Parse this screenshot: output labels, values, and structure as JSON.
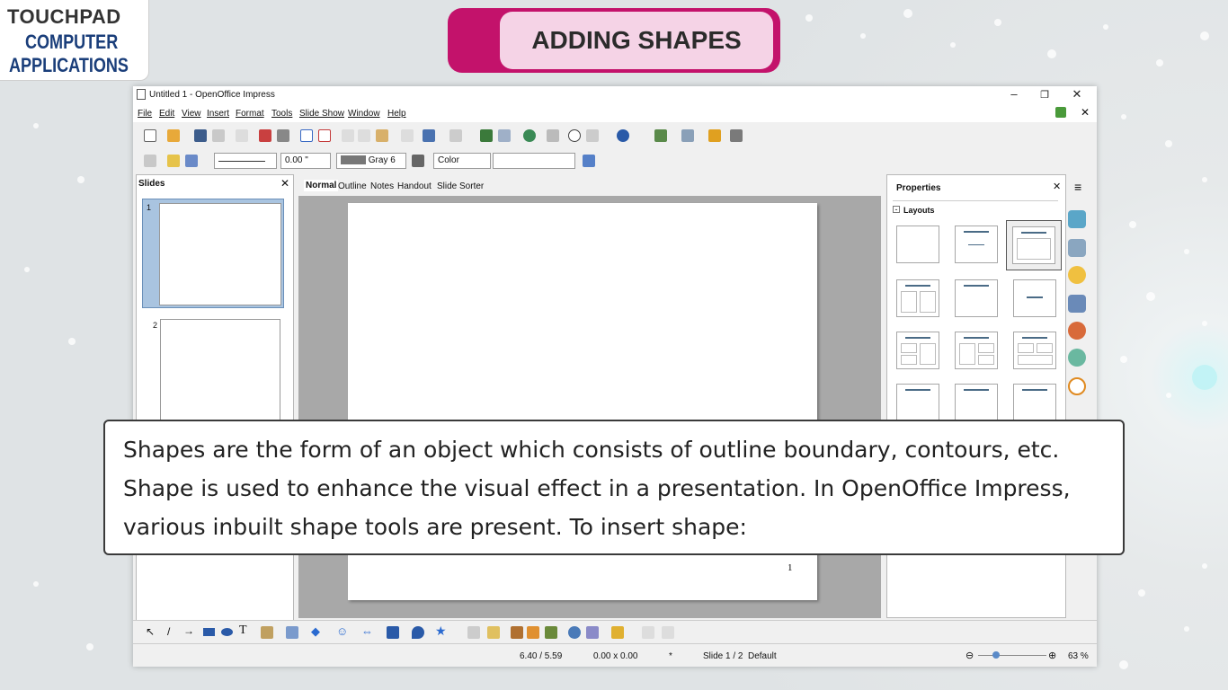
{
  "logo": {
    "brand": "TOUCHPAD",
    "line1": "COMPUTER",
    "line2": "APPLICATIONS"
  },
  "heading": "ADDING SHAPES",
  "window": {
    "title": "Untitled 1 - OpenOffice Impress",
    "menu": [
      "File",
      "Edit",
      "View",
      "Insert",
      "Format",
      "Tools",
      "Slide Show",
      "Window",
      "Help"
    ]
  },
  "toolbar2": {
    "line_width": "0.00 \"",
    "line_color": "Gray 6",
    "area_style": "Color"
  },
  "slides_panel": {
    "title": "Slides",
    "slide_numbers": [
      "1",
      "2"
    ]
  },
  "view_tabs": [
    "Normal",
    "Outline",
    "Notes",
    "Handout",
    "Slide Sorter"
  ],
  "slide": {
    "page_number": "1"
  },
  "properties": {
    "title": "Properties",
    "section": "Layouts"
  },
  "status": {
    "position": "6.40 / 5.59",
    "size": "0.00 x 0.00",
    "slide": "Slide 1 / 2",
    "layout": "Default",
    "zoom": "63 %"
  },
  "explanation": "Shapes are the form of an object which consists of outline boundary, contours, etc. Shape is used to enhance the visual effect in a presentation. In OpenOffice Impress, various inbuilt shape tools are present. To insert shape:"
}
